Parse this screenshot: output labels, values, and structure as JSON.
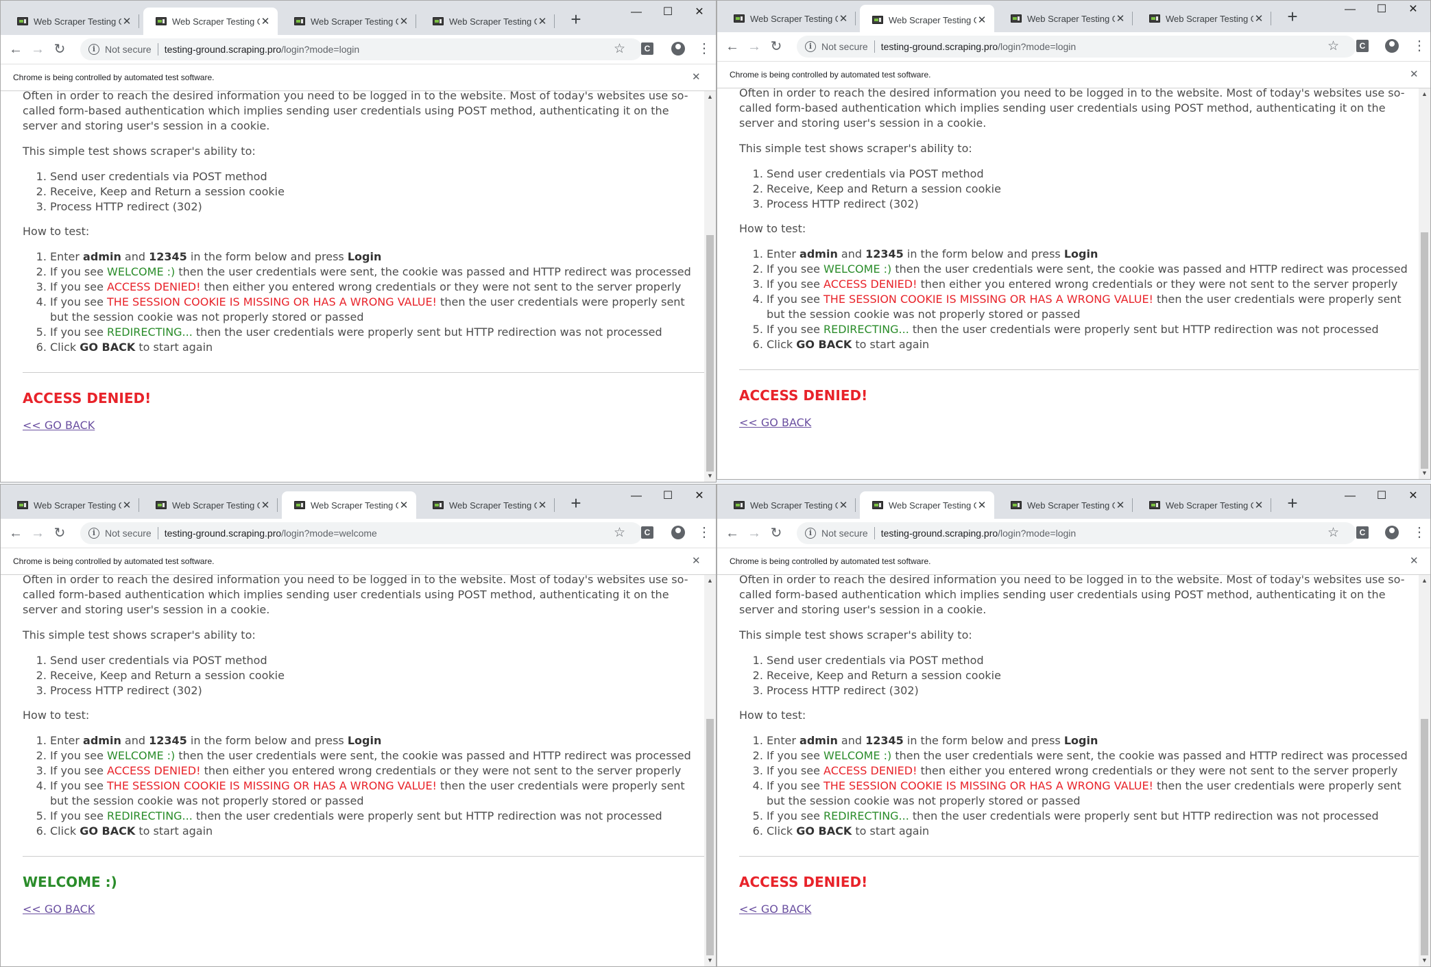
{
  "windows": [
    {
      "tabs": [
        "Web Scraper Testing Grou",
        "Web Scraper Testing Grou",
        "Web Scraper Testing Grou",
        "Web Scraper Testing Grou"
      ],
      "active_tab": 1,
      "not_secure": "Not secure",
      "url_host": "testing-ground.scraping.pro",
      "url_path": "/login?mode=login",
      "result": "ACCESS DENIED!",
      "result_status": "denied"
    },
    {
      "tabs": [
        "Web Scraper Testing Grou",
        "Web Scraper Testing Grou",
        "Web Scraper Testing Grou",
        "Web Scraper Testing Grou"
      ],
      "active_tab": 1,
      "not_secure": "Not secure",
      "url_host": "testing-ground.scraping.pro",
      "url_path": "/login?mode=login",
      "result": "ACCESS DENIED!",
      "result_status": "denied"
    },
    {
      "tabs": [
        "Web Scraper Testing Grou",
        "Web Scraper Testing Grou",
        "Web Scraper Testing Grou",
        "Web Scraper Testing Grou"
      ],
      "active_tab": 2,
      "not_secure": "Not secure",
      "url_host": "testing-ground.scraping.pro",
      "url_path": "/login?mode=welcome",
      "result": "WELCOME :)",
      "result_status": "welcome"
    },
    {
      "tabs": [
        "Web Scraper Testing Grou",
        "Web Scraper Testing Grou",
        "Web Scraper Testing Grou",
        "Web Scraper Testing Grou"
      ],
      "active_tab": 1,
      "not_secure": "Not secure",
      "url_host": "testing-ground.scraping.pro",
      "url_path": "/login?mode=login",
      "result": "ACCESS DENIED!",
      "result_status": "denied"
    }
  ],
  "infobar_text": "Chrome is being controlled by automated test software.",
  "page": {
    "intro": "Often in order to reach the desired information you need to be logged in to the website. Most of today's websites use so-called form-based authentication which implies sending user credentials using POST method, authenticating it on the server and storing user's session in a cookie.",
    "ability_heading": "This simple test shows scraper's ability to:",
    "abilities": [
      "Send user credentials via POST method",
      "Receive, Keep and Return a session cookie",
      "Process HTTP redirect (302)"
    ],
    "how_heading": "How to test:",
    "steps": {
      "s1_pre": "Enter ",
      "s1_user": "admin",
      "s1_and": " and ",
      "s1_pass": "12345",
      "s1_mid": " in the form below and press ",
      "s1_login": "Login",
      "s2_pre": "If you see ",
      "s2_key": "WELCOME :)",
      "s2_post": " then the user credentials were sent, the cookie was passed and HTTP redirect was processed",
      "s3_pre": "If you see ",
      "s3_key": "ACCESS DENIED!",
      "s3_post": " then either you entered wrong credentials or they were not sent to the server properly",
      "s4_pre": "If you see ",
      "s4_key": "THE SESSION COOKIE IS MISSING OR HAS A WRONG VALUE!",
      "s4_post": " then the user credentials were properly sent but the session cookie was not properly stored or passed",
      "s5_pre": "If you see ",
      "s5_key": "REDIRECTING...",
      "s5_post": " then the user credentials were properly sent but HTTP redirection was not processed",
      "s6_pre": "Click ",
      "s6_key": "GO BACK",
      "s6_post": " to start again"
    },
    "go_back": "<< GO BACK"
  },
  "colors": {
    "green": "#2a8c2a",
    "red": "#e8232a",
    "link": "#6a4fa0",
    "tabstrip": "#dee1e6"
  },
  "icons": {
    "back": "arrow-left-icon",
    "forward": "arrow-right-icon",
    "reload": "reload-icon",
    "info": "info-icon",
    "bookmark": "star-icon",
    "extension": "extension-icon",
    "profile": "profile-icon",
    "menu": "kebab-menu-icon"
  }
}
